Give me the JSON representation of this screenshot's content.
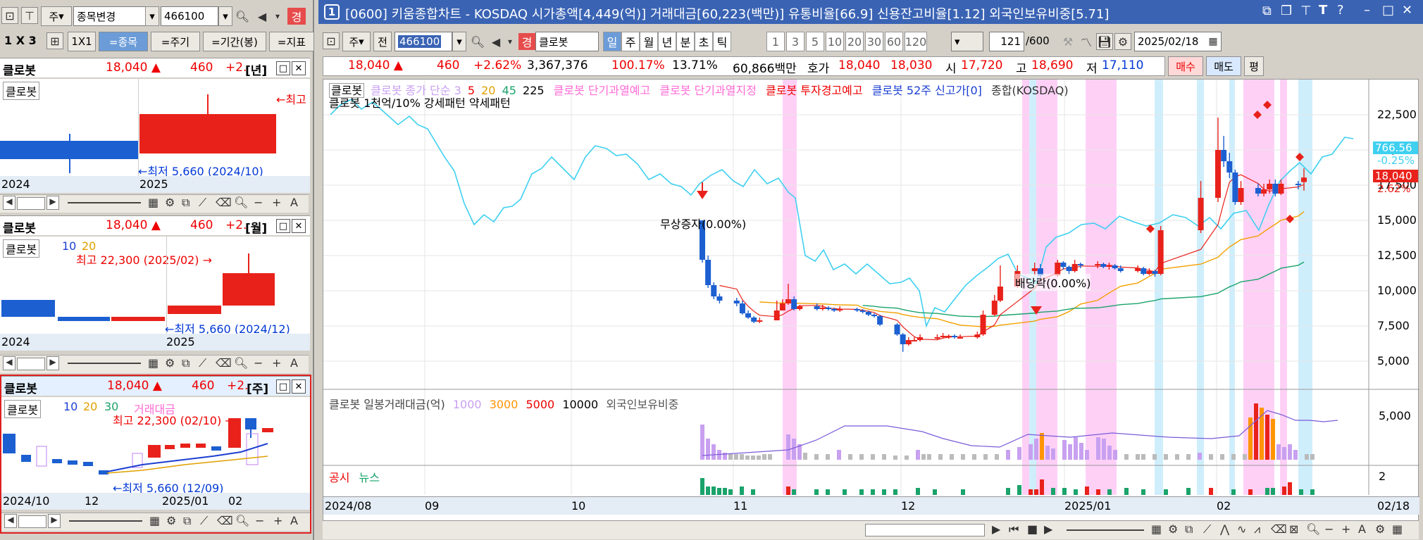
{
  "left": {
    "toolbar": {
      "stock_label": "주",
      "change_stock": "종목변경",
      "code": "466100",
      "badge": "경"
    },
    "tabs": {
      "grid_label": "1 X 3",
      "one_by_one": "1X1",
      "by_stock": "=종목",
      "by_period": "=주기",
      "by_range": "=기간(봉)",
      "by_indicator": "=지표"
    },
    "panels": [
      {
        "name": "클로봇",
        "price": "18,040 ▲",
        "change": "460",
        "pct": "+2.",
        "period": "[년]",
        "legend": "클로봇",
        "annot_high": "←최고",
        "annot_low": "←최저 5,660 (2024/10)",
        "x_labels": [
          "2024",
          "2025"
        ]
      },
      {
        "name": "클로봇",
        "price": "18,040 ▲",
        "change": "460",
        "pct": "+2.",
        "period": "[월]",
        "legend": "클로봇",
        "ma1": "10",
        "ma2": "20",
        "annot_high": "최고 22,300 (2025/02) →",
        "annot_low": "←최저 5,660 (2024/12)",
        "x_labels": [
          "2024",
          "2025"
        ]
      },
      {
        "name": "클로봇",
        "price": "18,040 ▲",
        "change": "460",
        "pct": "+2.",
        "period": "[주]",
        "legend": "클로봇",
        "ma1": "10",
        "ma2": "20",
        "ma3": "30",
        "vol_label": "거래대금",
        "annot_high": "최고 22,300 (02/10) →",
        "annot_low": "←최저 5,660 (12/09)",
        "x_labels": [
          "2024/10",
          "12",
          "2025/01",
          "02"
        ]
      }
    ]
  },
  "main": {
    "title_num": "1",
    "title": "[0600] 키움종합차트 - KOSDAQ 시가총액[4,449(억)] 거래대금[60,223(백만)] 유통비율[66.9] 신용잔고비율[1.12] 외국인보유비중[5.71]",
    "toolbar": {
      "stock_label": "주",
      "jeon": "전",
      "code": "466100",
      "badge": "경",
      "name": "클로봇",
      "periods": [
        "일",
        "주",
        "월",
        "년",
        "분",
        "초",
        "틱"
      ],
      "numbers": [
        "1",
        "3",
        "5",
        "10",
        "20",
        "30",
        "60",
        "120"
      ],
      "count": "121",
      "count_total": "/600",
      "date": "2025/02/18"
    },
    "quote": {
      "price": "18,040 ▲",
      "change": "460",
      "pct": "+2.62%",
      "volume": "3,367,376",
      "vol_ratio": "100.17%",
      "turnover": "13.71%",
      "amount": "60,866백만",
      "hoga_label": "호가",
      "ask": "18,040",
      "bid": "18,030",
      "open_label": "시",
      "open": "17,720",
      "high_label": "고",
      "high": "18,690",
      "low_label": "저",
      "low": "17,110",
      "buy": "매수",
      "sell": "매도",
      "eval": "평"
    },
    "legend1": {
      "stock": "클로봇",
      "ma_text": "클로봇 종가 단순 3",
      "ma5": "5",
      "ma20": "20",
      "ma45": "45",
      "ma225": "225",
      "i1": "클로봇 단기과열예고",
      "i2": "클로봇 단기과열지정",
      "i3": "클로봇 투자경고예고",
      "i4": "클로봇 52주 신고가[0]",
      "i5": "종합(KOSDAQ)"
    },
    "legend2": "클로봇 1천억/10% 강세패턴  약세패턴",
    "annot_bonus": "무상증자(0.00%)",
    "annot_div": "배당락(0.00%)",
    "y_axis": [
      "22,500",
      "20,000",
      "17,500",
      "15,000",
      "12,500",
      "10,000",
      "7,500",
      "5,000"
    ],
    "price_tags": {
      "index": "766.56",
      "index_pct": "-0.25%",
      "price": "18,040",
      "price_pct": "2.62%"
    },
    "volume_panel": {
      "legend": "클로봇 일봉거래대금(억)",
      "m1000": "1000",
      "m3000": "3000",
      "m5000": "5000",
      "m10000": "10000",
      "foreign": "외국인보유비중",
      "y_label": "5,000"
    },
    "news_panel": {
      "disclosure": "공시",
      "news": "뉴스",
      "y_label": "2"
    },
    "x_axis": [
      "2024/08",
      "09",
      "10",
      "11",
      "12",
      "2025/01",
      "02"
    ],
    "x_axis_right": "02/18"
  },
  "chart_data": {
    "type": "candlestick",
    "x": [
      "2024-11-05",
      "2024-11-06",
      "2024-11-07",
      "2024-11-08",
      "2024-11-11",
      "2024-11-12",
      "2024-11-13",
      "2024-11-14",
      "2024-11-15",
      "2024-11-18",
      "2024-11-19",
      "2024-11-20",
      "2024-11-21",
      "2024-11-22",
      "2024-11-25",
      "2024-11-26",
      "2024-11-27",
      "2024-11-28",
      "2024-11-29",
      "2024-12-02",
      "2024-12-03",
      "2024-12-04",
      "2024-12-05",
      "2024-12-06",
      "2024-12-09",
      "2024-12-10",
      "2024-12-11",
      "2024-12-12",
      "2024-12-13",
      "2024-12-16",
      "2024-12-17",
      "2024-12-18",
      "2024-12-19",
      "2024-12-20",
      "2024-12-23",
      "2024-12-24",
      "2024-12-26",
      "2024-12-27",
      "2024-12-30",
      "2025-01-02",
      "2025-01-03",
      "2025-01-06",
      "2025-01-07",
      "2025-01-08",
      "2025-01-09",
      "2025-01-10",
      "2025-01-13",
      "2025-01-14",
      "2025-01-15",
      "2025-01-16",
      "2025-01-17",
      "2025-01-20",
      "2025-01-21",
      "2025-01-22",
      "2025-01-23",
      "2025-01-24",
      "2025-01-31",
      "2025-02-03",
      "2025-02-04",
      "2025-02-05",
      "2025-02-06",
      "2025-02-07",
      "2025-02-10",
      "2025-02-11",
      "2025-02-12",
      "2025-02-13",
      "2025-02-14",
      "2025-02-17",
      "2025-02-18"
    ],
    "close": [
      12200,
      10400,
      9600,
      9300,
      9100,
      8400,
      8100,
      7800,
      7900,
      8600,
      9100,
      9400,
      8700,
      8900,
      8700,
      8800,
      8700,
      8600,
      8700,
      8600,
      8500,
      8300,
      8200,
      7600,
      6900,
      6200,
      6500,
      6500,
      6700,
      6700,
      6800,
      6800,
      6700,
      6700,
      6900,
      8300,
      9300,
      10300,
      11400,
      11600,
      11100,
      12000,
      11700,
      11400,
      11900,
      11800,
      11900,
      11700,
      11800,
      11600,
      11400,
      11600,
      11200,
      11400,
      11200,
      14300,
      16600,
      20000,
      19200,
      18400,
      16300,
      17300,
      16900,
      17200,
      17600,
      16900,
      17600,
      17580,
      18040
    ],
    "open": [
      15000,
      12200,
      10400,
      9600,
      9300,
      9100,
      8400,
      8100,
      7800,
      7900,
      8600,
      9100,
      9400,
      8700,
      8900,
      8700,
      8800,
      8700,
      8600,
      8700,
      8600,
      8500,
      8300,
      8200,
      7600,
      6900,
      6200,
      6500,
      6500,
      6700,
      6700,
      6800,
      6800,
      6700,
      6700,
      6900,
      8300,
      9300,
      10300,
      11400,
      11600,
      11100,
      12000,
      11700,
      11400,
      11900,
      11800,
      11900,
      11700,
      11800,
      11600,
      11400,
      11600,
      11200,
      11400,
      11200,
      14300,
      16600,
      20000,
      19200,
      18400,
      16300,
      17300,
      16900,
      17200,
      17600,
      16900,
      17600,
      17720
    ],
    "high": [
      15000,
      12500,
      10600,
      9800,
      9500,
      9300,
      8600,
      8200,
      8100,
      9300,
      9400,
      10500,
      9600,
      9000,
      9100,
      9000,
      8900,
      8800,
      8900,
      8800,
      8700,
      8600,
      8400,
      8300,
      7700,
      7000,
      6700,
      6700,
      6900,
      6900,
      7000,
      6900,
      6900,
      6900,
      7100,
      8600,
      9700,
      11800,
      11800,
      12000,
      11900,
      12200,
      12100,
      11800,
      12200,
      12000,
      12100,
      12000,
      12000,
      11900,
      11800,
      11800,
      11700,
      11600,
      11500,
      14600,
      17800,
      22300,
      21000,
      19800,
      18600,
      17800,
      17600,
      17600,
      17900,
      17900,
      17900,
      17800,
      18690
    ],
    "low": [
      12000,
      10200,
      9400,
      9100,
      8900,
      8300,
      8000,
      7700,
      7700,
      7900,
      8600,
      9000,
      8600,
      8600,
      8600,
      8600,
      8600,
      8500,
      8500,
      8500,
      8400,
      8200,
      8100,
      7500,
      6800,
      5660,
      6100,
      6400,
      6400,
      6500,
      6600,
      6600,
      6600,
      6600,
      6600,
      6800,
      8200,
      9200,
      10200,
      11100,
      10900,
      11000,
      11500,
      11200,
      11300,
      11600,
      11600,
      11600,
      11500,
      11500,
      11300,
      11300,
      11100,
      11100,
      11000,
      11100,
      14100,
      16300,
      18800,
      18000,
      16100,
      16100,
      16700,
      16700,
      16900,
      16700,
      16800,
      17200,
      17110
    ],
    "ylim": [
      5000,
      23500
    ]
  }
}
